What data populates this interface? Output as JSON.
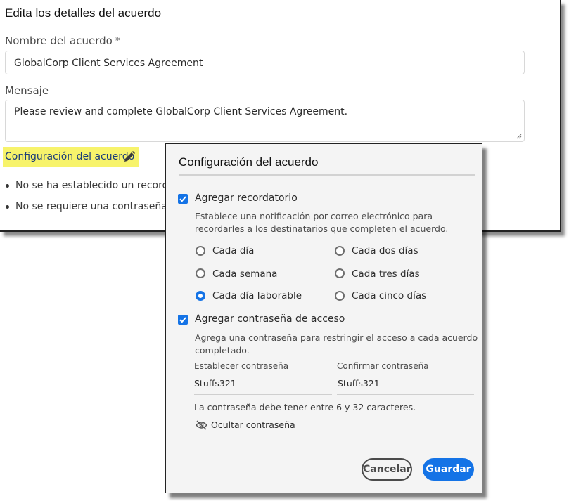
{
  "background_form": {
    "title": "Edita los detalles del acuerdo",
    "name_label": "Nombre del acuerdo",
    "required_mark": "*",
    "name_value": "GlobalCorp Client Services Agreement",
    "message_label": "Mensaje",
    "message_value": "Please review and complete GlobalCorp Client Services Agreement.",
    "config_link": "Configuración del acuerdo",
    "bullets": [
      "No se ha establecido un recordat",
      "No se requiere una contraseña pa"
    ]
  },
  "dialog": {
    "title": "Configuración del acuerdo",
    "reminder": {
      "label": "Agregar recordatorio",
      "checked": true,
      "description_line1": "Establece una notificación por correo electrónico para",
      "description_line2": "recordarles a los destinatarios que completen el acuerdo.",
      "options": [
        {
          "label": "Cada día",
          "selected": false
        },
        {
          "label": "Cada dos días",
          "selected": false
        },
        {
          "label": "Cada semana",
          "selected": false
        },
        {
          "label": "Cada tres días",
          "selected": false
        },
        {
          "label": "Cada día laborable",
          "selected": true
        },
        {
          "label": "Cada cinco días",
          "selected": false
        }
      ]
    },
    "password": {
      "label": "Agregar contraseña de acceso",
      "checked": true,
      "description_line1": "Agrega una contraseña para restringir el acceso a cada acuerdo",
      "description_line2": "completado.",
      "set_label": "Establecer contraseña",
      "set_value": "Stuffs321",
      "confirm_label": "Confirmar contraseña",
      "confirm_value": "Stuffs321",
      "hint": "La contraseña debe tener entre 6 y 32 caracteres.",
      "toggle_label": "Ocultar contraseña"
    },
    "cancel_label": "Cancelar",
    "save_label": "Guardar"
  },
  "colors": {
    "accent": "#1473e6",
    "highlight": "#f7f36b",
    "link": "#1b3c7a"
  }
}
